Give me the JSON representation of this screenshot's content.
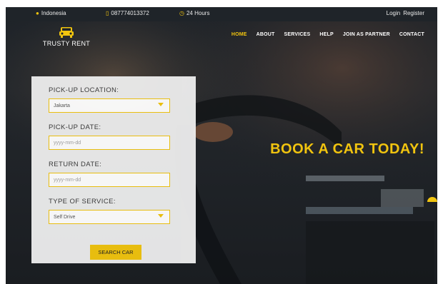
{
  "topbar": {
    "location": "Indonesia",
    "phone": "087774013372",
    "hours": "24 Hours",
    "login": "Login",
    "register": "Register"
  },
  "brand": {
    "name": "TRUSTY RENT",
    "logo_icon": "car-icon"
  },
  "nav": {
    "items": [
      "HOME",
      "ABOUT",
      "SERVICES",
      "HELP",
      "JOIN AS PARTNER",
      "CONTACT"
    ],
    "active": "HOME"
  },
  "booking": {
    "pickup_location_label": "PICK-UP LOCATION:",
    "pickup_location_value": "Jakarta",
    "pickup_date_label": "PICK-UP DATE:",
    "pickup_date_placeholder": "yyyy-mm-dd",
    "return_date_label": "RETURN DATE:",
    "return_date_placeholder": "yyyy-mm-dd",
    "service_label": "TYPE OF SERVICE:",
    "service_value": "Self Drive",
    "search_button": "SEARCH CAR"
  },
  "hero": {
    "headline": "BOOK A CAR TODAY!"
  },
  "colors": {
    "accent": "#f1c40f",
    "dark": "#1f2429",
    "panel": "#ececec"
  }
}
